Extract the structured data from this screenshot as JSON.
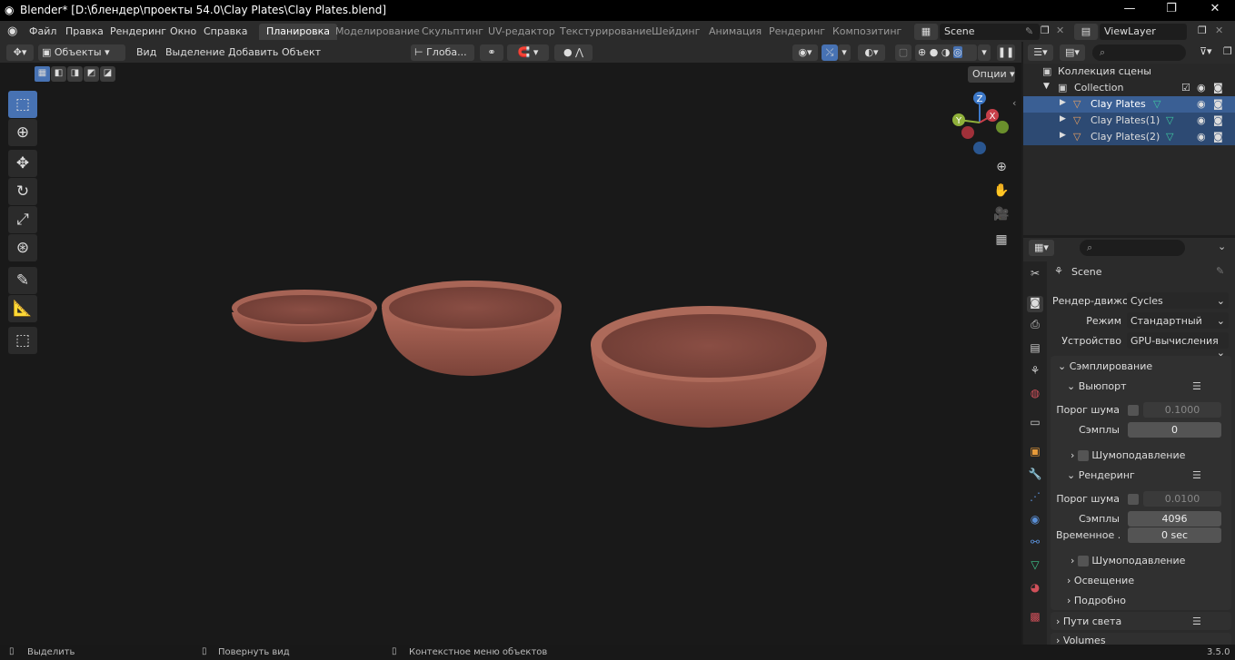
{
  "window": {
    "title": "Blender* [D:\\блендер\\проекты 54.0\\Clay Plates\\Clay Plates.blend]"
  },
  "menu": {
    "items": [
      "Файл",
      "Правка",
      "Рендеринг",
      "Окно",
      "Справка"
    ]
  },
  "workspaces": [
    "Планировка",
    "Моделирование",
    "Скульптинг",
    "UV-редактор",
    "Текстурирование",
    "Шейдинг",
    "Анимация",
    "Рендеринг",
    "Композитинг"
  ],
  "scene": {
    "name": "Scene"
  },
  "viewlayer": {
    "name": "ViewLayer"
  },
  "viewport_header": {
    "mode": "Объекты",
    "menus": [
      "Вид",
      "Выделение",
      "Добавить",
      "Объект"
    ],
    "transform_orientation": "Глоба...",
    "options": "Опции"
  },
  "gizmo": {
    "x": "X",
    "y": "Y",
    "z": "Z"
  },
  "outliner": {
    "scene_collection": "Коллекция сцены",
    "collection": "Collection",
    "objects": [
      "Clay Plates",
      "Clay Plates(1)",
      "Clay Plates(2)"
    ]
  },
  "properties": {
    "scene_name": "Scene",
    "render_engine_label": "Рендер-движок",
    "render_engine": "Cycles",
    "mode_label": "Режим",
    "mode": "Стандартный",
    "device_label": "Устройство",
    "device": "GPU-вычисления",
    "sampling": "Сэмплирование",
    "viewport": "Выюпорт",
    "noise_threshold_label": "Порог шума",
    "viewport_noise_threshold": "0.1000",
    "samples_label": "Сэмплы",
    "viewport_samples": "0",
    "denoise": "Шумоподавление",
    "render": "Рендеринг",
    "render_noise_threshold": "0.0100",
    "render_samples": "4096",
    "time_limit_label": "Временное ...",
    "time_limit": "0 sec",
    "lights": "Освещение",
    "advanced": "Подробно",
    "light_paths": "Пути света",
    "volumes": "Volumes"
  },
  "statusbar": {
    "select": "Выделить",
    "rotate": "Повернуть вид",
    "context": "Контекстное меню объектов",
    "version": "3.5.0"
  },
  "colors": {
    "accent": "#4772b3",
    "plate": "#a05d4f",
    "x_axis": "#c8404a",
    "y_axis": "#8fb03a",
    "z_axis": "#3c78c8"
  }
}
